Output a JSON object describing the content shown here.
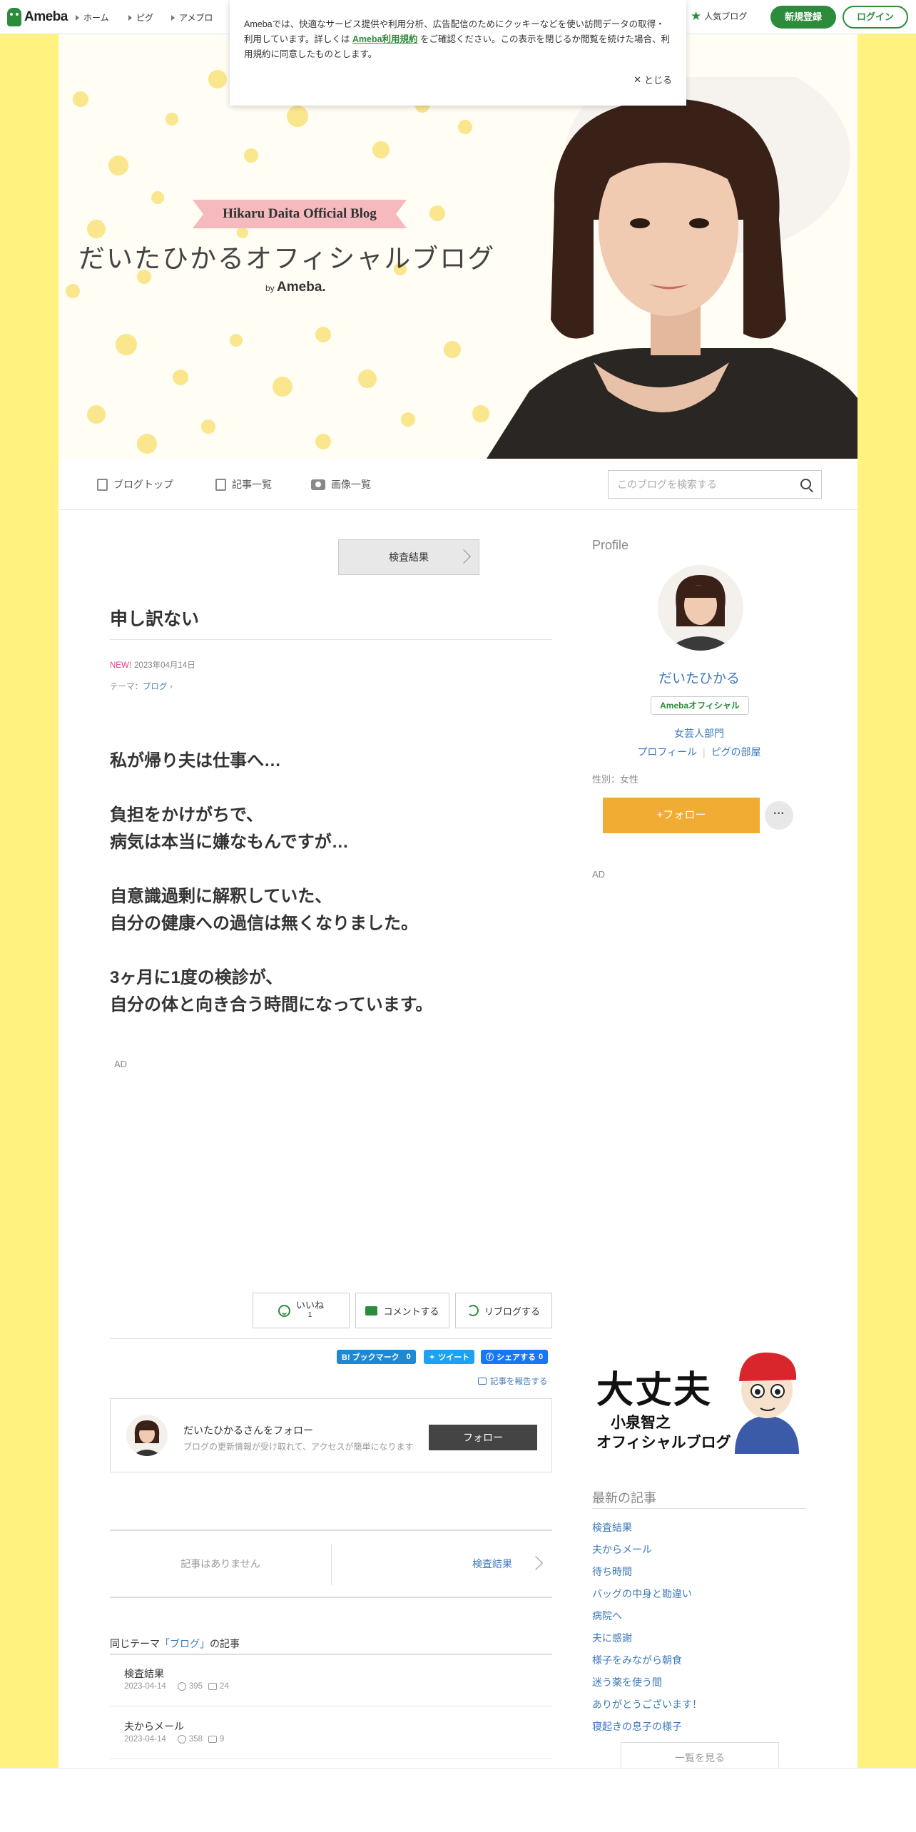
{
  "topbar": {
    "logo": "Ameba",
    "nav": [
      "ホーム",
      "ピグ",
      "アメブロ"
    ],
    "popular": "人気ブログ",
    "signup": "新規登録",
    "login": "ログイン"
  },
  "cookie": {
    "text_before": "Amebaでは、快適なサービス提供や利用分析、広告配信のためにクッキーなどを使い訪問データの取得・利用しています。詳しくは ",
    "terms_link": "Ameba利用規約",
    "text_after": " をご確認ください。この表示を閉じるか閲覧を続けた場合、利用規約に同意したものとします。",
    "close": "とじる"
  },
  "header": {
    "ribbon": "Hikaru Daita Official Blog",
    "title": "だいたひかるオフィシャルブログ",
    "by": "by",
    "ameba": "Ameba."
  },
  "blognav": {
    "top": "ブログトップ",
    "entries": "記事一覧",
    "images": "画像一覧",
    "search_placeholder": "このブログを検索する"
  },
  "main": {
    "search_result_btn": "検査結果",
    "title": "申し訳ない",
    "new_label": "NEW!",
    "date": "2023年04月14日",
    "theme_prefix": "テーマ：",
    "theme": "ブログ",
    "paragraphs": [
      "私が帰り夫は仕事へ…",
      "負担をかけがちで、\n病気は本当に嫌なもんですが…",
      "自意識過剰に解釈していた、\n自分の健康への過信は無くなりました。",
      "3ヶ月に1度の検診が、\n自分の体と向き合う時間になっています。"
    ],
    "ad": "AD",
    "actions": {
      "like": "いいね",
      "like_count": "1",
      "comment": "コメントする",
      "reblog": "リブログする"
    },
    "share": {
      "hatena": "B! ブックマーク",
      "hatena_count": "0",
      "tweet": "ツイート",
      "facebook": "シェアする",
      "facebook_count": "0"
    },
    "report": "記事を報告する",
    "follow_card": {
      "title": "だいたひかるさんをフォロー",
      "sub": "ブログの更新情報が受け取れて、アクセスが簡単になります",
      "button": "フォロー"
    },
    "prevnext": {
      "prev": "記事はありません",
      "next": "検査結果"
    },
    "theme_articles": {
      "heading_pre": "同じテーマ",
      "heading_theme": "「ブログ」",
      "heading_post": "の記事",
      "items": [
        {
          "title": "検査結果",
          "date": "2023-04-14",
          "likes": "395",
          "comments": "24"
        },
        {
          "title": "夫からメール",
          "date": "2023-04-14",
          "likes": "358",
          "comments": "9"
        }
      ]
    }
  },
  "sidebar": {
    "profile_heading": "Profile",
    "name": "だいたひかる",
    "badge": "Amebaオフィシャル",
    "category": "女芸人部門",
    "links": [
      "プロフィール",
      "ピグの部屋"
    ],
    "gender": "性別：女性",
    "follow": "+フォロー",
    "more": "···",
    "ad": "AD",
    "banner": {
      "big": "大丈夫",
      "sub1": "小泉智之",
      "sub2": "オフィシャルブログ"
    },
    "recent_heading": "最新の記事",
    "recent": [
      "検査結果",
      "夫からメール",
      "待ち時間",
      "バッグの中身と勘違い",
      "病院へ",
      "夫に感謝",
      "様子をみながら朝食",
      "迷う薬を使う間",
      "ありがとうございます！",
      "寝起きの息子の様子"
    ],
    "see_all": "一覧を見る"
  },
  "colors": {
    "accent_green": "#2d8c3c",
    "background_yellow": "#fff27f",
    "follow_orange": "#f0ac33",
    "link_blue": "#3e7ab8"
  }
}
